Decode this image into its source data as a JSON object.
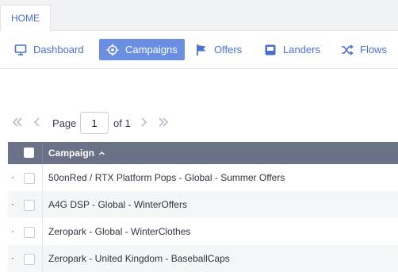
{
  "tabs": {
    "home_label": "HOME"
  },
  "nav": {
    "items": [
      {
        "label": "Dashboard",
        "icon": "monitor-icon",
        "active": false
      },
      {
        "label": "Campaigns",
        "icon": "target-icon",
        "active": true
      },
      {
        "label": "Offers",
        "icon": "flag-icon",
        "active": false
      },
      {
        "label": "Landers",
        "icon": "square-icon",
        "active": false
      },
      {
        "label": "Flows",
        "icon": "shuffle-icon",
        "active": false
      }
    ]
  },
  "pagination": {
    "page_label": "Page",
    "current_page": "1",
    "of_label": "of 1"
  },
  "table": {
    "column_header": "Campaign",
    "sort": "ascending",
    "rows": [
      {
        "campaign": "50onRed / RTX Platform Pops - Global - Summer Offers"
      },
      {
        "campaign": "A4G DSP - Global - WinterOffers"
      },
      {
        "campaign": "Zeropark - Global - WinterClothes"
      },
      {
        "campaign": "Zeropark - United Kingdom - BaseballCaps"
      }
    ]
  },
  "colors": {
    "accent": "#4a6fd0",
    "active_nav_bg": "#6a8fe2",
    "table_header_bg": "#697286"
  }
}
